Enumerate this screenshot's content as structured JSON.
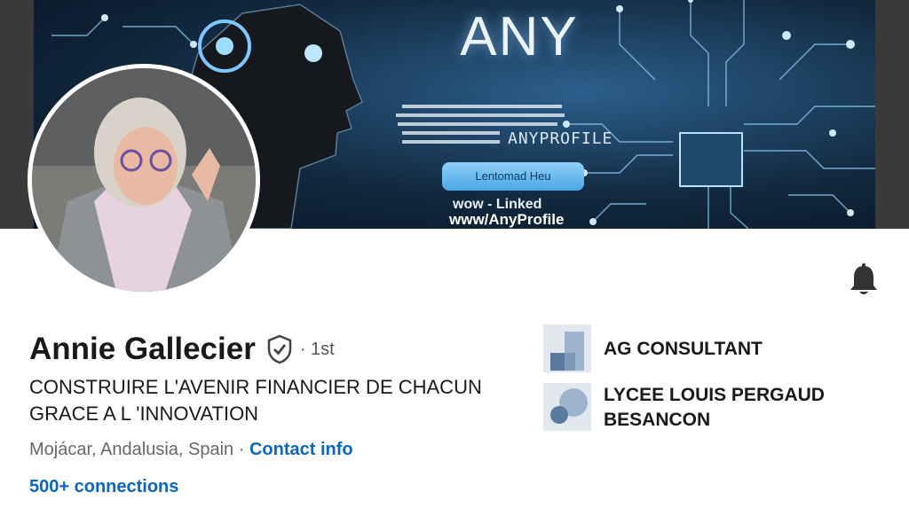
{
  "banner": {
    "title": "ANY",
    "handle": "ANYPROFILE",
    "button_label": "Lentomad Heu",
    "url_line1": "wow - Linked",
    "url_line2": "www/AnyProfile"
  },
  "profile": {
    "name": "Annie Gallecier",
    "degree": "· 1st",
    "headline": "CONSTRUIRE L'AVENIR FINANCIER DE CHACUN GRACE A L 'INNOVATION",
    "location": "Mojácar, Andalusia, Spain",
    "separator": " · ",
    "contact_label": "Contact info",
    "connections": "500+ connections"
  },
  "organizations": [
    {
      "name": "AG CONSULTANT",
      "icon": "company-logo-icon"
    },
    {
      "name": "LYCEE LOUIS PERGAUD BESANCON",
      "icon": "school-logo-icon"
    }
  ],
  "icons": {
    "bell": "bell-icon",
    "verified": "verified-shield-icon"
  },
  "colors": {
    "link": "#0a66c2",
    "text": "#191919",
    "muted": "#666666"
  }
}
